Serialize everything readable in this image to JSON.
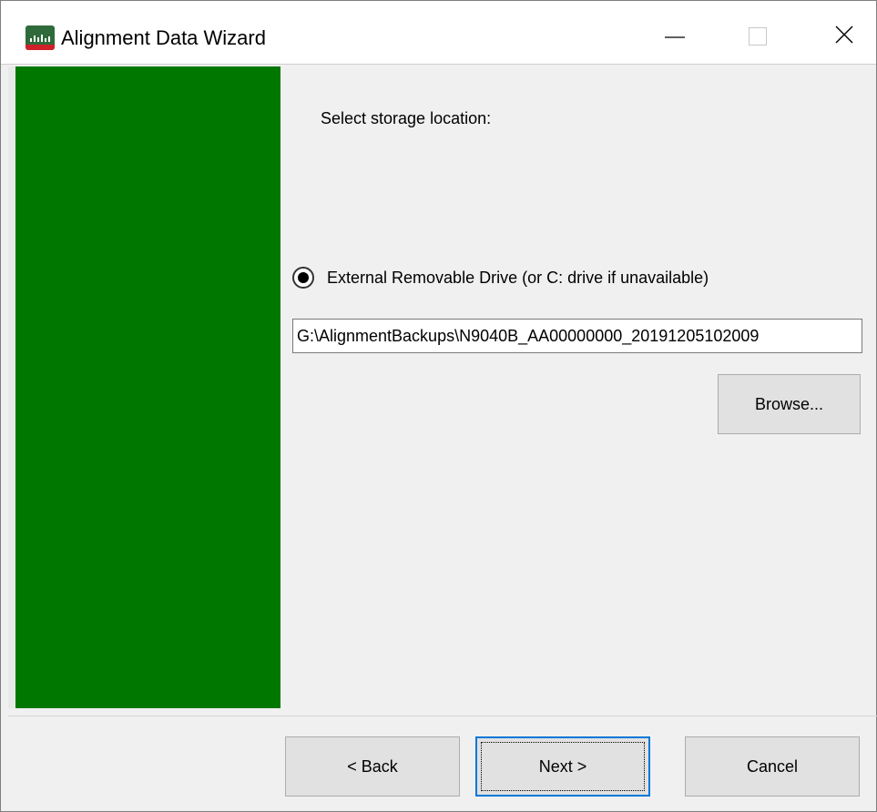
{
  "window": {
    "title": "Alignment Data Wizard",
    "icon": "keysight-app-icon",
    "controls": [
      "minimize-icon",
      "maximize-icon",
      "close-icon"
    ]
  },
  "colors": {
    "side_panel": "#007800",
    "focus_border": "#0078d7",
    "app_icon_band": "#d0202a"
  },
  "content": {
    "heading": "Select storage location:",
    "radio": {
      "label": "External Removable Drive (or C: drive if unavailable)",
      "selected": true
    },
    "path_value": "G:\\AlignmentBackups\\N9040B_AA00000000_20191205102009",
    "browse_label": "Browse..."
  },
  "footer": {
    "back_label": "< Back",
    "next_label": "Next >",
    "cancel_label": "Cancel"
  }
}
